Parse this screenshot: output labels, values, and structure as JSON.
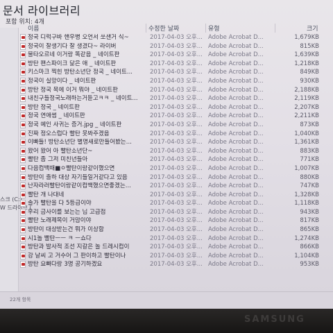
{
  "library": {
    "title": "문서 라이브러리",
    "subtitle": "포함 위치: 4개"
  },
  "columns": {
    "name": "이름",
    "date": "수정한 날짜",
    "type": "유형",
    "size": "크기"
  },
  "nav": {
    "items": [
      {
        "label": "스크 (C:)"
      },
      {
        "label": "W 드라이브 ("
      }
    ]
  },
  "rows": [
    {
      "name": "정국 디럭구바 핸우병 오언서 쏘샌거 식~",
      "date": "2017-04-03 오후...",
      "type": "Adobe Acrobat D...",
      "size": "1,679KB"
    },
    {
      "name": "정국이 잘생기다 잘 생겼다~ 라이버",
      "date": "2017-04-03 오후...",
      "type": "Adobe Acrobat D...",
      "size": "815KB"
    },
    {
      "name": "불타오르네 이거랑 똑같음 _ 네이트판",
      "date": "2017-04-03 오후...",
      "type": "Adobe Acrobat D...",
      "size": "1,639KB"
    },
    {
      "name": "방탄 팬스파이크 닮은 애 _ 네이트판",
      "date": "2017-04-03 오후...",
      "type": "Adobe Acrobat D...",
      "size": "1,218KB"
    },
    {
      "name": "키스마크 찍힌 방탄소년단 정국 _ 네이트...",
      "date": "2017-04-03 오후...",
      "type": "Adobe Acrobat D...",
      "size": "849KB"
    },
    {
      "name": "정국이 실망이다 _ 네이트판",
      "date": "2017-04-03 오후...",
      "type": "Adobe Acrobat D...",
      "size": "930KB"
    },
    {
      "name": "방탄 정국 목에 이거 뭐야 _ 네이트판",
      "date": "2017-04-03 오후...",
      "type": "Adobe Acrobat D...",
      "size": "2,188KB"
    },
    {
      "name": "내친구들정국노래하는거듣고ㅋㅋ _ 네이트...",
      "date": "2017-04-03 오후...",
      "type": "Adobe Acrobat D...",
      "size": "2,119KB"
    },
    {
      "name": "방탄 정국 _ 네이트판",
      "date": "2017-04-03 오후...",
      "type": "Adobe Acrobat D...",
      "size": "2,207KB"
    },
    {
      "name": "정국 연애썸 _ 네이트판",
      "date": "2017-04-03 오후...",
      "type": "Adobe Acrobat D...",
      "size": "2,211KB"
    },
    {
      "name": "정국 예인 사귀는 증거.jpg _ 네이트판",
      "date": "2017-04-03 오후...",
      "type": "Adobe Acrobat D...",
      "size": "873KB"
    },
    {
      "name": "진짜 정오스럽다 빨탄 못봐주겠음",
      "date": "2017-04-03 오후...",
      "type": "Adobe Acrobat D...",
      "size": "1,040KB"
    },
    {
      "name": "이빠들! 방탄소년단 별명새로만들어봤는...",
      "date": "2017-04-03 오후...",
      "type": "Adobe Acrobat D...",
      "size": "1,361KB"
    },
    {
      "name": "왔어 왔어 아 빨탄소년단~",
      "date": "2017-04-03 오후...",
      "type": "Adobe Acrobat D...",
      "size": "883KB"
    },
    {
      "name": "빨탄 좀 그저 미친년들아",
      "date": "2017-04-03 오후...",
      "type": "Adobe Acrobat D...",
      "size": "771KB"
    },
    {
      "name": "다음컴백때■ㅇ빨탄이랑같이했으면",
      "date": "2017-04-03 오후...",
      "type": "Adobe Acrobat D...",
      "size": "1,007KB"
    },
    {
      "name": "방탄이 출하 대상 자기들일거같다고 있음",
      "date": "2017-04-03 오후...",
      "type": "Adobe Acrobat D...",
      "size": "880KB"
    },
    {
      "name": "난자라러빨탄이랑같이컴백했으면좋겠는...",
      "date": "2017-04-03 오후...",
      "type": "Adobe Acrobat D...",
      "size": "747KB"
    },
    {
      "name": "빨탄 개 나대네",
      "date": "2017-04-03 오후...",
      "type": "Adobe Acrobat D...",
      "size": "1,328KB"
    },
    {
      "name": "솔가 빨탄을 다 5등급이야",
      "date": "2017-04-03 오후...",
      "type": "Adobe Acrobat D...",
      "size": "1,118KB"
    },
    {
      "name": "우리 금사이를 보는는 님 고급점",
      "date": "2017-04-03 오후...",
      "type": "Adobe Acrobat D...",
      "size": "943KB"
    },
    {
      "name": "빨탄 노래제목이 거맘이야",
      "date": "2017-04-03 오후...",
      "type": "Adobe Acrobat D...",
      "size": "817KB"
    },
    {
      "name": "방탄이 대상받는건 뭐가 이상함",
      "date": "2017-04-03 오후...",
      "type": "Adobe Acrobat D...",
      "size": "865KB"
    },
    {
      "name": "시1놀 빨탄ㅡㅡ ㅋ ㅡ쇼다",
      "date": "2017-04-03 오후...",
      "type": "Adobe Acrobat D...",
      "size": "1,274KB"
    },
    {
      "name": "방탄과 발사적 조선 지갈은 놀 드레시컴이",
      "date": "2017-04-03 오후...",
      "type": "Adobe Acrobat D...",
      "size": "866KB"
    },
    {
      "name": "강 날씨 고 거수어 그 판이하고 빨탄이나",
      "date": "2017-04-03 오후...",
      "type": "Adobe Acrobat D...",
      "size": "1,104KB"
    },
    {
      "name": "방탄 요빠다랑 3명 공기하겠요",
      "date": "2017-04-03 오후...",
      "type": "Adobe Acrobat D...",
      "size": "953KB"
    }
  ],
  "status": {
    "text": "22개 항목"
  },
  "bezel": {
    "brand": "SAMSUNG"
  }
}
